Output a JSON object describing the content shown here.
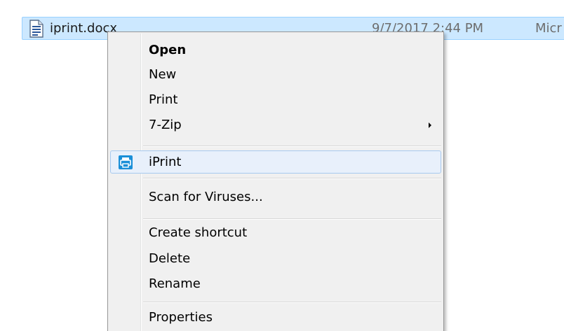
{
  "file": {
    "name": "iprint.docx",
    "modified": "9/7/2017 2:44 PM",
    "type": "Micr",
    "icon": "word-document-icon"
  },
  "menu": {
    "items": [
      {
        "label": "Open",
        "bold": true
      },
      {
        "label": "New"
      },
      {
        "label": "Print"
      },
      {
        "label": "7-Zip",
        "submenu": true
      },
      {
        "label": "iPrint",
        "icon": "printer-icon",
        "highlighted": true
      },
      {
        "label": "Scan for Viruses..."
      },
      {
        "label": "Create shortcut"
      },
      {
        "label": "Delete"
      },
      {
        "label": "Rename"
      },
      {
        "label": "Properties"
      }
    ]
  },
  "colors": {
    "selection_bg": "#cce8ff",
    "selection_border": "#99d1ff",
    "menu_bg": "#f0f0f0",
    "hover_bg": "#e8f0fb",
    "hover_border": "#a7c9ef",
    "iprint_icon": "#1a8fd8"
  }
}
